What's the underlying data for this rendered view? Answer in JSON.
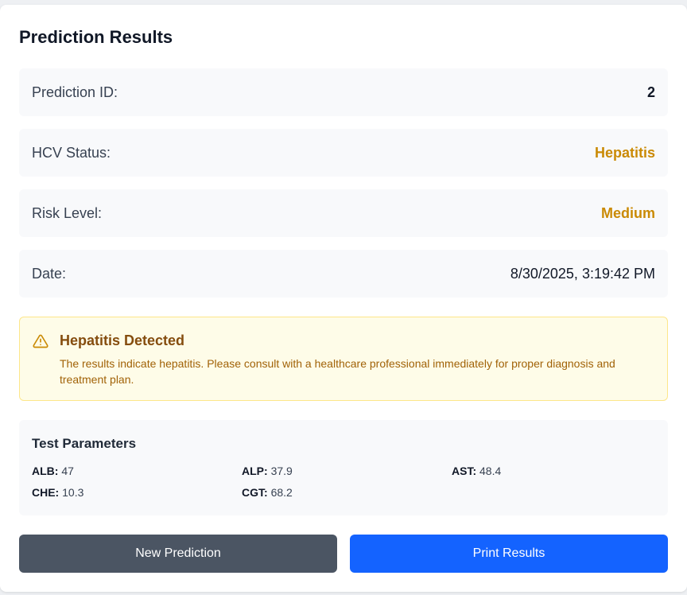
{
  "title": "Prediction Results",
  "rows": [
    {
      "label": "Prediction ID:",
      "value": "2"
    },
    {
      "label": "HCV Status:",
      "value": "Hepatitis"
    },
    {
      "label": "Risk Level:",
      "value": "Medium"
    },
    {
      "label": "Date:",
      "value": "8/30/2025, 3:19:42 PM"
    }
  ],
  "alert": {
    "icon": "warning-triangle-icon",
    "heading": "Hepatitis Detected",
    "message": "The results indicate hepatitis. Please consult with a healthcare professional immediately for proper diagnosis and treatment plan."
  },
  "parameters": {
    "heading": "Test Parameters",
    "items": [
      {
        "key": "ALB:",
        "value": "47"
      },
      {
        "key": "ALP:",
        "value": "37.9"
      },
      {
        "key": "AST:",
        "value": "48.4"
      },
      {
        "key": "CHE:",
        "value": "10.3"
      },
      {
        "key": "CGT:",
        "value": "68.2"
      }
    ]
  },
  "buttons": {
    "new_prediction": "New Prediction",
    "print_results": "Print Results"
  },
  "colors": {
    "warning": "#ca8a04",
    "primary": "#1463ff",
    "secondary": "#4b5563"
  }
}
